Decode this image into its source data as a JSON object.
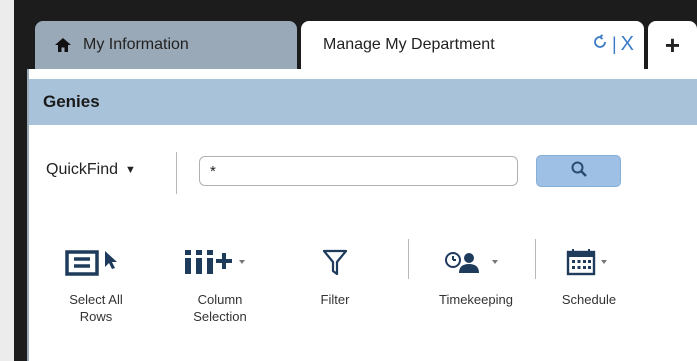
{
  "tabs": {
    "my_information": "My Information",
    "manage_department": "Manage My Department",
    "add_symbol": "+",
    "close_symbol": "X"
  },
  "panel": {
    "title": "Genies"
  },
  "quickfind": {
    "label": "QuickFind",
    "input_value": "*"
  },
  "toolbar": {
    "select_all": "Select All Rows",
    "column_selection": "Column Selection",
    "filter": "Filter",
    "timekeeping": "Timekeeping",
    "schedule": "Schedule"
  },
  "colors": {
    "tab_inactive": "#9aa9b7",
    "header_bar": "#a8c3d9",
    "search_button": "#9dc0e4",
    "accent_blue": "#3b7bc6"
  },
  "icons": [
    "home-icon",
    "refresh-icon",
    "close-icon",
    "add-tab-icon",
    "search-icon",
    "select-all-icon",
    "column-selection-icon",
    "filter-icon",
    "timekeeping-icon",
    "schedule-icon"
  ]
}
